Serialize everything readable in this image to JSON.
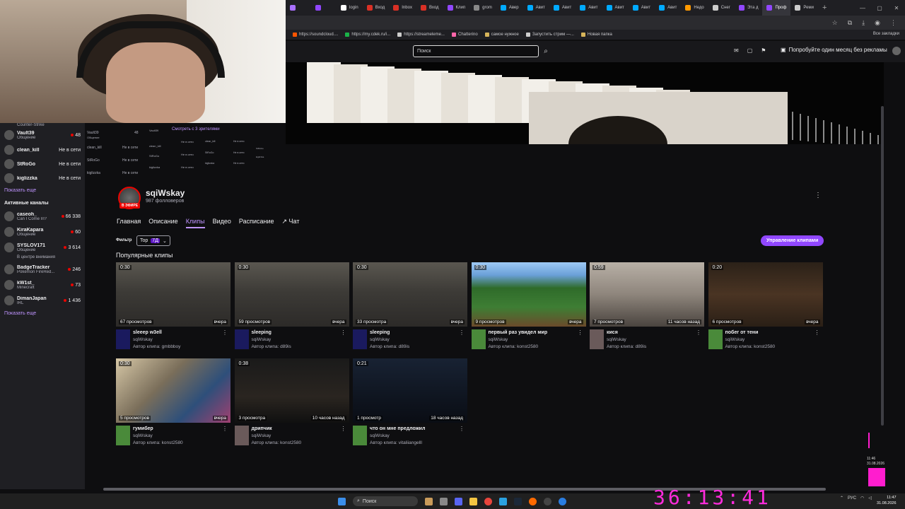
{
  "browser": {
    "tabs": [
      {
        "label": "",
        "color": "#a970ff"
      },
      {
        "label": "",
        "color": "#9147ff"
      },
      {
        "label": "login",
        "color": "#ffffff"
      },
      {
        "label": "Вход",
        "color": "#d93025"
      },
      {
        "label": "Inbox",
        "color": "#d93025"
      },
      {
        "label": "Вход",
        "color": "#d93025"
      },
      {
        "label": "Клип",
        "color": "#9147ff"
      },
      {
        "label": "grom",
        "color": "#888888"
      },
      {
        "label": "Авер",
        "color": "#00aaff"
      },
      {
        "label": "Авит",
        "color": "#00aaff"
      },
      {
        "label": "Авит",
        "color": "#00aaff"
      },
      {
        "label": "Авит",
        "color": "#00aaff"
      },
      {
        "label": "Авит",
        "color": "#00aaff"
      },
      {
        "label": "Авит",
        "color": "#00aaff"
      },
      {
        "label": "Авит",
        "color": "#00aaff"
      },
      {
        "label": "Недо",
        "color": "#ff9900"
      },
      {
        "label": "Снег",
        "color": "#cccccc"
      },
      {
        "label": "Эта д",
        "color": "#9147ff"
      },
      {
        "label": "Проф",
        "color": "#9147ff",
        "active": true
      },
      {
        "label": "Реми",
        "color": "#cccccc"
      }
    ],
    "new_tab": "+",
    "bookmarks": [
      {
        "label": "https://soundcloud....",
        "color": "#ff5500"
      },
      {
        "label": "https://my.cdek.ru/i...",
        "color": "#1ab248"
      },
      {
        "label": "https://streameleme...",
        "color": "#cccccc"
      },
      {
        "label": "Chatterino",
        "color": "#ff66aa"
      },
      {
        "label": "самое нужное",
        "color": "#d6b45a"
      },
      {
        "label": "Запустить стрим —...",
        "color": "#cccccc"
      },
      {
        "label": "Новая папка",
        "color": "#d6b45a"
      }
    ],
    "all_bookmarks": "Все закладки"
  },
  "topnav": {
    "search_placeholder": "Поиск",
    "turbo_label": "Попробуйте один месяц без рекламы"
  },
  "sidebar": {
    "followed": [
      {
        "name": "Vault39",
        "sub": "Общение",
        "right": "48",
        "live": true
      },
      {
        "name": "clean_kill",
        "sub": "",
        "right": "Не в сети",
        "live": false
      },
      {
        "name": "StRoGo",
        "sub": "",
        "right": "Не в сети",
        "live": false
      },
      {
        "name": "kiglizzka",
        "sub": "",
        "right": "Не в сети",
        "live": false
      }
    ],
    "show_more_1": "Показать еще",
    "active_heading": "Активные каналы",
    "active": [
      {
        "name": "caseoh_",
        "sub": "Can I Come In?",
        "right": "66 338",
        "live": true
      },
      {
        "name": "KiraKapara",
        "sub": "Общение",
        "right": "60",
        "live": true
      },
      {
        "name": "SYSLOV171",
        "sub": "Общение",
        "right": "3 614",
        "live": true
      },
      {
        "name": "BadgeTracker",
        "sub": "Pokémon FireRed...",
        "right": "246",
        "live": true
      },
      {
        "name": "kW1st_",
        "sub": "Minecraft",
        "right": "73",
        "live": true
      },
      {
        "name": "DimanJapan",
        "sub": "IRL",
        "right": "1 436",
        "live": true
      }
    ],
    "spotlight_note": "В центре внимания",
    "show_more_2": "Показать еще",
    "top_cut": "Counter-Strike"
  },
  "echo": {
    "watch_label": "Смотреть с 3 зрителями"
  },
  "channel": {
    "name": "sqiWskay",
    "followers": "987 фолловеров",
    "live_badge": "В ЭФИРЕ",
    "tabs": [
      "Главная",
      "Описание",
      "Клипы",
      "Видео",
      "Расписание",
      "Чат"
    ],
    "active_tab": 2,
    "filter_label": "Фильтр",
    "filter_value": "Top",
    "filter_badge": "7Д",
    "manage_label": "Управление клипами",
    "section_title": "Популярные клипы"
  },
  "clips": [
    {
      "duration": "0:30",
      "views": "67 просмотров",
      "date": "вчера",
      "title": "sleeep w3ell",
      "channel": "sqiWskay",
      "author": "Автор клипа: gmbbboy",
      "thumb": "room"
    },
    {
      "duration": "0:30",
      "views": "59 просмотров",
      "date": "вчера",
      "title": "sleeping",
      "channel": "sqiWskay",
      "author": "Автор клипа: d89is",
      "thumb": "room"
    },
    {
      "duration": "0:30",
      "views": "33 просмотра",
      "date": "вчера",
      "title": "sleeping",
      "channel": "sqiWskay",
      "author": "Автор клипа: d89is",
      "thumb": "room"
    },
    {
      "duration": "0:30",
      "views": "9 просмотров",
      "date": "вчера",
      "title": "первый раз увидел мир",
      "channel": "sqiWskay",
      "author": "Автор клипа: konst2580",
      "thumb": "mc"
    },
    {
      "duration": "0:59",
      "views": "7 просмотров",
      "date": "11 часов назад",
      "title": "кися",
      "channel": "sqiWskay",
      "author": "Автор клипа: d89is",
      "thumb": "room2"
    },
    {
      "duration": "0:20",
      "views": "6 просмотров",
      "date": "вчера",
      "title": "побег от тени",
      "channel": "sqiWskay",
      "author": "Автор клипа: konst2580",
      "thumb": "cave"
    },
    {
      "duration": "0:30",
      "views": "5 просмотров",
      "date": "вчера",
      "title": "гумибер",
      "channel": "sqiWskay",
      "author": "Автор клипа: konst2580",
      "thumb": "collage"
    },
    {
      "duration": "0:38",
      "views": "3 просмотра",
      "date": "10 часов назад",
      "title": "дрипчик",
      "channel": "sqiWskay",
      "author": "Автор клипа: konst2580",
      "thumb": "dark"
    },
    {
      "duration": "0:21",
      "views": "1 просмотр",
      "date": "18 часов назад",
      "title": "что он мне предложил",
      "channel": "sqiWskay",
      "author": "Автор клипа: vitaliiangelll",
      "thumb": "night"
    }
  ],
  "taskbar": {
    "search_label": "Поиск",
    "lang": "РУС",
    "time": "11:47",
    "date": "31.08.2026"
  },
  "overlay": {
    "timer": "36:13:41",
    "mini_time": "11:46",
    "mini_date": "31.08.2026"
  }
}
